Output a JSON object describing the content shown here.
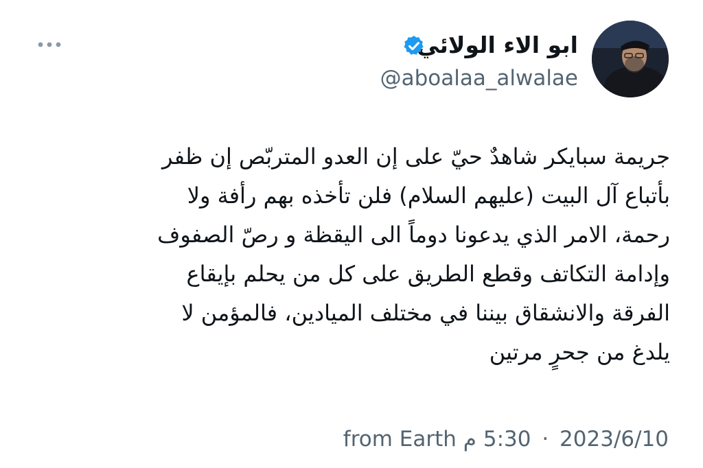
{
  "author": {
    "display_name": "ابو الاء الولائي",
    "handle": "@aboalaa_alwalae",
    "avatar_icon": "person-avatar",
    "verified_icon": "verified-badge-icon",
    "verified_color": "#1d9bf0"
  },
  "more_icon": "more-horizontal-icon",
  "tweet": {
    "lines": [
      "جريمة سبايكر شاهدٌ حيّ على إن العدو المتربّص إن ظفر",
      "بأتباع آل البيت (عليهم السلام) فلن تأخذه بهم رأفة ولا",
      "رحمة، الامر الذي يدعونا دوماً الى اليقظة و رصّ الصفوف",
      "وإدامة التكاتف وقطع الطريق على كل من يحلم بإيقاع",
      "الفرقة والانشقاق بيننا في مختلف الميادين، فالمؤمن لا",
      "يلدغ من جحرٍ مرتين"
    ]
  },
  "meta": {
    "source": "from Earth",
    "time": "5:30 م",
    "date": "2023/6/10",
    "separator": "·"
  }
}
